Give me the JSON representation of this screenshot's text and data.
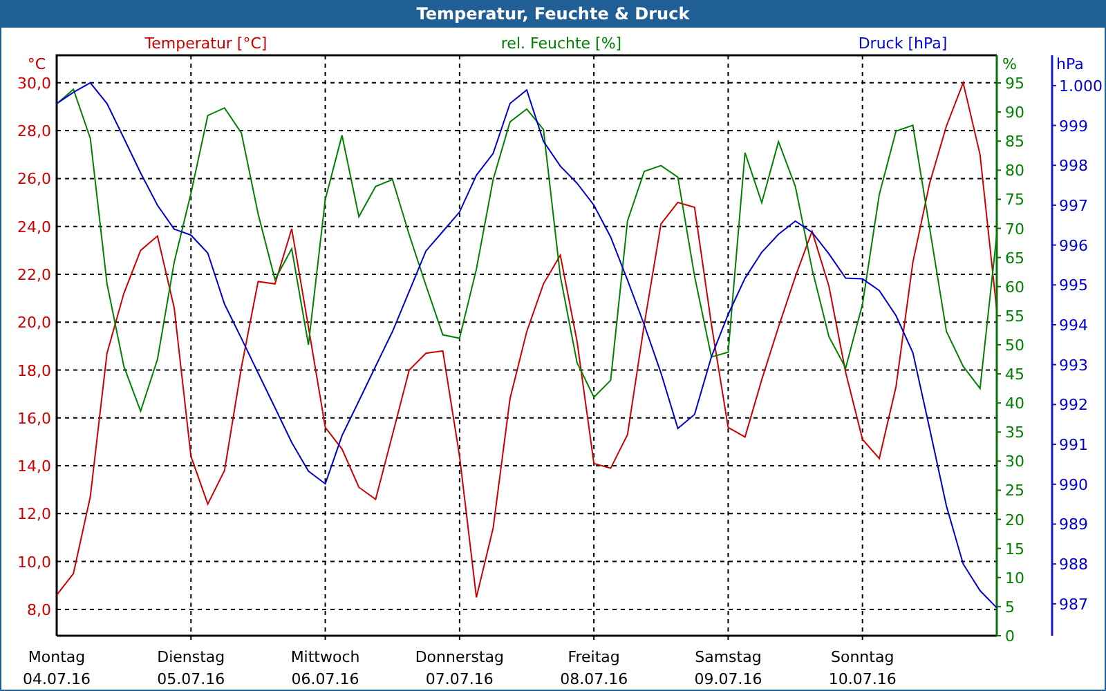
{
  "window": {
    "title": "Temperatur, Feuchte & Druck"
  },
  "x_dates": [
    "04.07.16",
    "05.07.16",
    "06.07.16",
    "07.07.16",
    "08.07.16",
    "09.07.16",
    "10.07.16"
  ],
  "temperature": {
    "chart_data": {
      "type": "line",
      "grid": true,
      "title": "Temperatur [°C]",
      "ylabel": "°C",
      "ylim": [
        6.9,
        31.15
      ],
      "categories": [
        "Montag",
        null,
        null,
        null,
        null,
        null,
        null,
        null,
        "Dienstag",
        null,
        null,
        null,
        null,
        null,
        null,
        null,
        "Mittwoch",
        null,
        null,
        null,
        null,
        null,
        null,
        null,
        "Donnerstag",
        null,
        null,
        null,
        null,
        null,
        null,
        null,
        "Freitag",
        null,
        null,
        null,
        null,
        null,
        null,
        null,
        "Samstag",
        null,
        null,
        null,
        null,
        null,
        null,
        null,
        "Sonntag",
        null,
        null,
        null,
        null,
        null,
        null,
        null,
        null
      ],
      "yticks": [
        {
          "value": 8,
          "label": "8,0"
        },
        {
          "value": 10,
          "label": "10,0"
        },
        {
          "value": 12,
          "label": "12,0"
        },
        {
          "value": 14,
          "label": "14,0"
        },
        {
          "value": 16,
          "label": "16,0"
        },
        {
          "value": 18,
          "label": "18,0"
        },
        {
          "value": 20,
          "label": "20,0"
        },
        {
          "value": 22,
          "label": "22,0"
        },
        {
          "value": 24,
          "label": "24,0"
        },
        {
          "value": 26,
          "label": "26,0"
        },
        {
          "value": 28,
          "label": "28,0"
        },
        {
          "value": 30,
          "label": "30,0"
        }
      ],
      "series": [
        {
          "color": "#cc0000",
          "values": [
            8.6,
            9.5,
            12.7,
            18.7,
            21.2,
            23.0,
            23.6,
            20.6,
            14.4,
            12.4,
            13.8,
            18.1,
            21.7,
            21.6,
            23.9,
            19.8,
            15.6,
            14.7,
            13.1,
            12.6,
            15.3,
            18.0,
            18.7,
            18.8,
            14.4,
            8.5,
            11.4,
            16.8,
            19.6,
            21.6,
            22.8,
            19.2,
            14.1,
            13.9,
            15.3,
            19.9,
            24.1,
            25.0,
            24.8,
            19.9,
            15.6,
            15.2,
            17.6,
            19.8,
            21.9,
            23.8,
            21.5,
            17.9,
            15.1,
            14.3,
            17.3,
            22.5,
            25.8,
            28.2,
            30.0,
            27.0,
            20.5
          ]
        }
      ]
    }
  },
  "humidity": {
    "chart_data": {
      "type": "line",
      "title": "rel. Feuchte [%]",
      "ylabel": "%",
      "ylim": [
        0,
        99.75
      ],
      "yticks": [
        {
          "value": 0,
          "label": "0"
        },
        {
          "value": 5,
          "label": "5"
        },
        {
          "value": 10,
          "label": "10"
        },
        {
          "value": 15,
          "label": "15"
        },
        {
          "value": 20,
          "label": "20"
        },
        {
          "value": 25,
          "label": "25"
        },
        {
          "value": 30,
          "label": "30"
        },
        {
          "value": 35,
          "label": "35"
        },
        {
          "value": 40,
          "label": "40"
        },
        {
          "value": 45,
          "label": "45"
        },
        {
          "value": 50,
          "label": "50"
        },
        {
          "value": 55,
          "label": "55"
        },
        {
          "value": 60,
          "label": "60"
        },
        {
          "value": 65,
          "label": "65"
        },
        {
          "value": 70,
          "label": "70"
        },
        {
          "value": 75,
          "label": "75"
        },
        {
          "value": 80,
          "label": "80"
        },
        {
          "value": 85,
          "label": "85"
        },
        {
          "value": 90,
          "label": "90"
        },
        {
          "value": 95,
          "label": "95"
        }
      ],
      "series": [
        {
          "color": "#008000",
          "values": [
            91.4,
            93.9,
            85.5,
            60.5,
            46.3,
            38.6,
            47.5,
            64.2,
            76,
            89.4,
            90.7,
            86.4,
            72.5,
            61.2,
            66.5,
            50,
            75,
            86,
            72,
            77.2,
            78.4,
            68.9,
            60.2,
            51.7,
            51.1,
            63,
            78.4,
            88.3,
            90.5,
            87,
            61.8,
            46.9,
            41,
            43.9,
            71.3,
            79.8,
            80.8,
            78.8,
            61.8,
            47.9,
            48.7,
            83,
            74.4,
            84.9,
            77.2,
            63,
            51.4,
            46,
            57,
            75.8,
            86.7,
            87.7,
            70.1,
            52.3,
            46.3,
            42.5,
            68.9
          ]
        }
      ]
    }
  },
  "pressure": {
    "chart_data": {
      "type": "line",
      "title": "Druck [hPa]",
      "ylabel": "hPa",
      "ylim": [
        986.2,
        1000.76
      ],
      "yticks": [
        {
          "value": 987,
          "label": "987"
        },
        {
          "value": 988,
          "label": "988"
        },
        {
          "value": 989,
          "label": "989"
        },
        {
          "value": 990,
          "label": "990"
        },
        {
          "value": 991,
          "label": "991"
        },
        {
          "value": 992,
          "label": "992"
        },
        {
          "value": 993,
          "label": "993"
        },
        {
          "value": 994,
          "label": "994"
        },
        {
          "value": 995,
          "label": "995"
        },
        {
          "value": 996,
          "label": "996"
        },
        {
          "value": 997,
          "label": "997"
        },
        {
          "value": 998,
          "label": "998"
        },
        {
          "value": 999,
          "label": "999"
        },
        {
          "value": 1000,
          "label": "1.000"
        }
      ],
      "series": [
        {
          "color": "#0000cc",
          "values": [
            999.55,
            999.83,
            1000.07,
            999.55,
            998.68,
            997.81,
            997.0,
            996.4,
            996.25,
            995.8,
            994.52,
            993.66,
            992.79,
            991.92,
            991.05,
            990.33,
            990.01,
            991.22,
            992.09,
            992.96,
            993.83,
            994.84,
            995.85,
            996.34,
            996.83,
            997.75,
            998.3,
            999.55,
            999.89,
            998.6,
            997.98,
            997.55,
            997.0,
            996.2,
            995.12,
            994.0,
            992.79,
            991.4,
            991.75,
            993.2,
            994.26,
            995.17,
            995.82,
            996.27,
            996.6,
            996.32,
            995.78,
            995.17,
            995.15,
            994.86,
            994.23,
            993.3,
            991.4,
            989.45,
            988.0,
            987.33,
            986.9
          ]
        }
      ]
    }
  }
}
